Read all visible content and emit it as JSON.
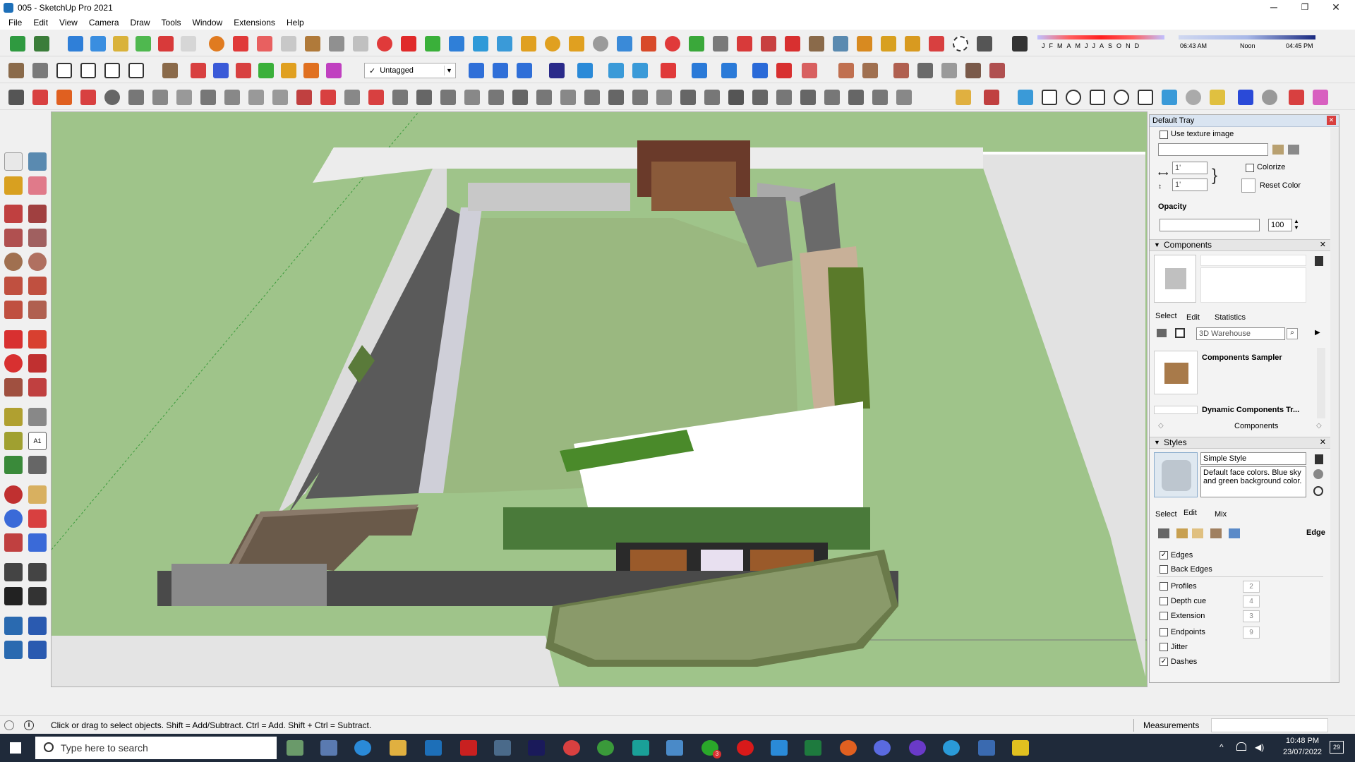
{
  "window": {
    "title": "005 - SketchUp Pro 2021",
    "minimize": "─",
    "maximize": "❐",
    "close": "✕"
  },
  "menu": [
    "File",
    "Edit",
    "View",
    "Camera",
    "Draw",
    "Tools",
    "Window",
    "Extensions",
    "Help"
  ],
  "tag_selector": {
    "check": "✓",
    "value": "Untagged"
  },
  "shadow": {
    "months": [
      "J",
      "F",
      "M",
      "A",
      "M",
      "J",
      "J",
      "A",
      "S",
      "O",
      "N",
      "D"
    ],
    "time_start": "06:43 AM",
    "time_mid": "Noon",
    "time_end": "04:45 PM"
  },
  "tray": {
    "title": "Default Tray",
    "materials": {
      "use_texture_label": "Use texture image",
      "width_value": "1'",
      "height_value": "1'",
      "colorize_label": "Colorize",
      "reset_color_label": "Reset Color",
      "opacity_label": "Opacity",
      "opacity_value": "100"
    },
    "components": {
      "title": "Components",
      "tabs": [
        "Select",
        "Edit",
        "Statistics"
      ],
      "search_placeholder": "3D Warehouse",
      "items": [
        "Components Sampler",
        "Dynamic Components Tr..."
      ],
      "footer": "Components"
    },
    "styles": {
      "title": "Styles",
      "style_name": "Simple Style",
      "style_desc": "Default face colors. Blue sky and green background color.",
      "tabs": [
        "Select",
        "Edit",
        "Mix"
      ],
      "edge_header": "Edge",
      "options": [
        {
          "label": "Edges",
          "checked": "✓",
          "value": ""
        },
        {
          "label": "Back Edges",
          "checked": "",
          "value": ""
        },
        {
          "label": "Profiles",
          "checked": "",
          "value": "2"
        },
        {
          "label": "Depth cue",
          "checked": "",
          "value": "4"
        },
        {
          "label": "Extension",
          "checked": "",
          "value": "3"
        },
        {
          "label": "Endpoints",
          "checked": "",
          "value": "9"
        },
        {
          "label": "Jitter",
          "checked": "",
          "value": ""
        },
        {
          "label": "Dashes",
          "checked": "✓",
          "value": ""
        }
      ]
    }
  },
  "status": {
    "message": "Click or drag to select objects. Shift = Add/Subtract. Ctrl = Add. Shift + Ctrl = Subtract.",
    "measurements_label": "Measurements",
    "measurements_value": ""
  },
  "taskbar": {
    "search_placeholder": "Type here to search",
    "time": "10:48 PM",
    "date": "23/07/2022",
    "notifications": "29",
    "whatsapp_badge": "3"
  },
  "colors": {
    "sky": "#9fc48a",
    "accent": "#1d6fb8",
    "taskbar": "#1f2a3a"
  }
}
